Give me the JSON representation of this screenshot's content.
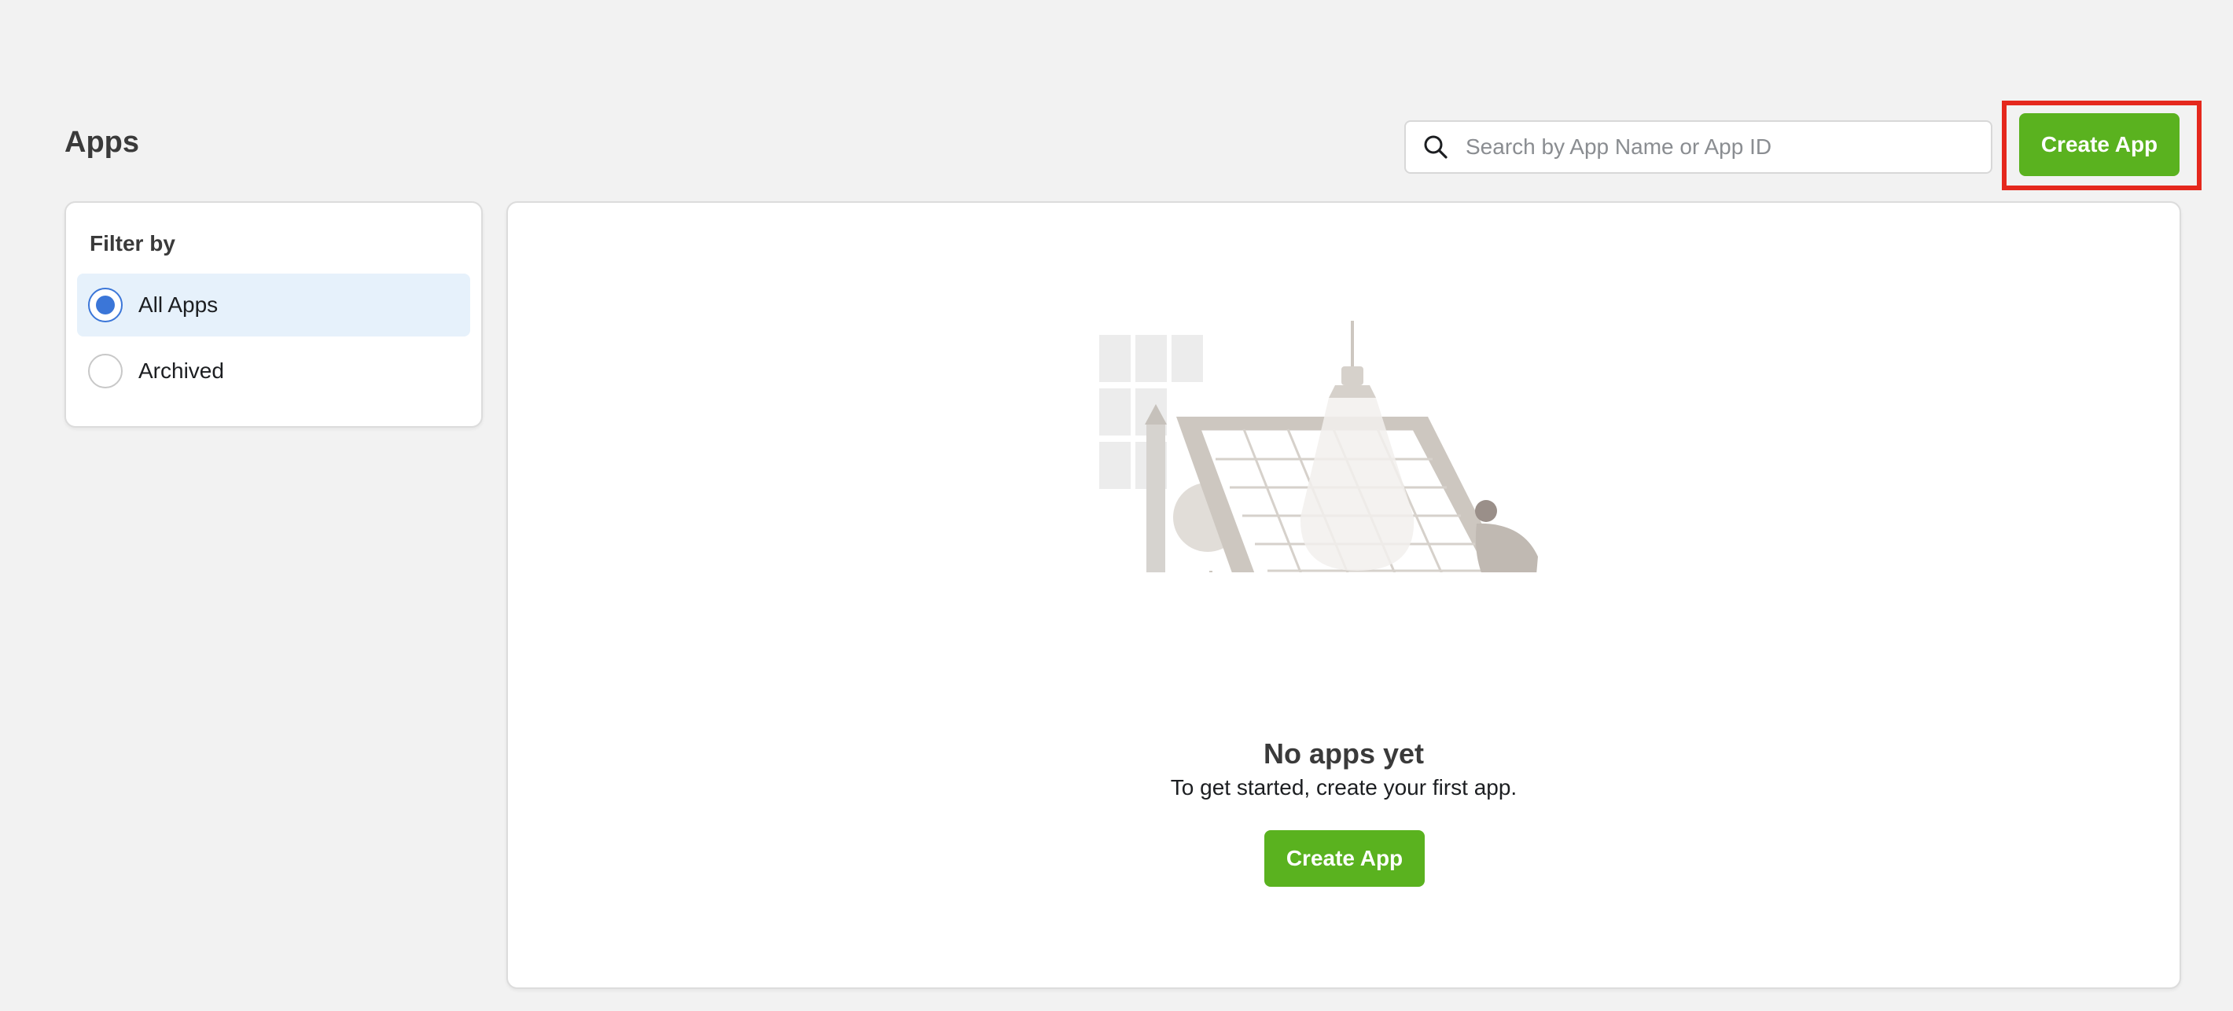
{
  "header": {
    "title": "Apps",
    "search": {
      "placeholder": "Search by App Name or App ID",
      "value": ""
    },
    "create_button": "Create App"
  },
  "filter": {
    "title": "Filter by",
    "options": [
      {
        "label": "All Apps",
        "selected": true
      },
      {
        "label": "Archived",
        "selected": false
      }
    ]
  },
  "empty_state": {
    "title": "No apps yet",
    "subtitle": "To get started, create your first app.",
    "button": "Create App",
    "illustration": "person-at-drafting-table-illustration"
  },
  "colors": {
    "primary_button": "#5ab21f",
    "radio_accent": "#3b76d8",
    "selected_row": "#e6f1fb",
    "highlight_frame": "#e5281d"
  }
}
